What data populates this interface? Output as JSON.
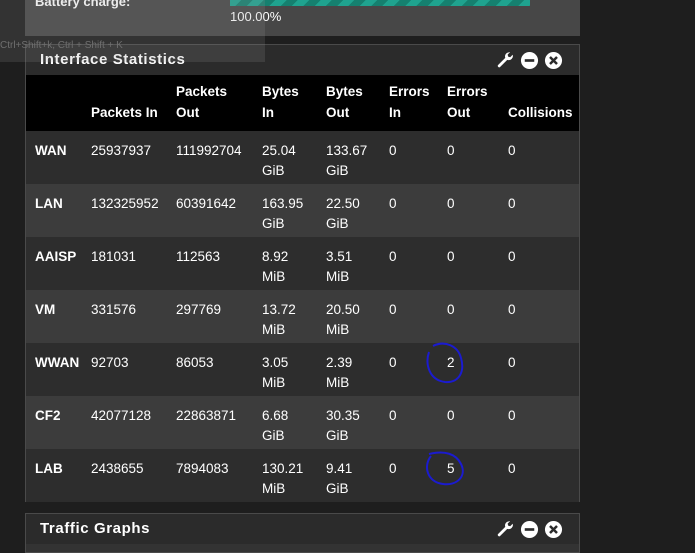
{
  "battery": {
    "label": "Battery charge:",
    "value": "100.00%",
    "charge_fraction": 1.0
  },
  "tooltip_ghost": {
    "text": "Ctrl+Shift+k, Ctrl + Shift + K"
  },
  "interface_statistics": {
    "title": "Interface Statistics",
    "headers": {
      "interface": "",
      "packets_in": "Packets In",
      "packets_out": "Packets Out",
      "bytes_in": "Bytes In",
      "bytes_out": "Bytes Out",
      "errors_in": "Errors In",
      "errors_out": "Errors Out",
      "collisions": "Collisions"
    },
    "rows": [
      {
        "name": "WAN",
        "packets_in": "25937937",
        "packets_out": "111992704",
        "bytes_in": "25.04 GiB",
        "bytes_out": "133.67 GiB",
        "errors_in": "0",
        "errors_out": "0",
        "collisions": "0"
      },
      {
        "name": "LAN",
        "packets_in": "132325952",
        "packets_out": "60391642",
        "bytes_in": "163.95 GiB",
        "bytes_out": "22.50 GiB",
        "errors_in": "0",
        "errors_out": "0",
        "collisions": "0"
      },
      {
        "name": "AAISP",
        "packets_in": "181031",
        "packets_out": "112563",
        "bytes_in": "8.92 MiB",
        "bytes_out": "3.51 MiB",
        "errors_in": "0",
        "errors_out": "0",
        "collisions": "0"
      },
      {
        "name": "VM",
        "packets_in": "331576",
        "packets_out": "297769",
        "bytes_in": "13.72 MiB",
        "bytes_out": "20.50 MiB",
        "errors_in": "0",
        "errors_out": "0",
        "collisions": "0"
      },
      {
        "name": "WWAN",
        "packets_in": "92703",
        "packets_out": "86053",
        "bytes_in": "3.05 MiB",
        "bytes_out": "2.39 MiB",
        "errors_in": "0",
        "errors_out": "2",
        "collisions": "0"
      },
      {
        "name": "CF2",
        "packets_in": "42077128",
        "packets_out": "22863871",
        "bytes_in": "6.68 GiB",
        "bytes_out": "30.35 GiB",
        "errors_in": "0",
        "errors_out": "0",
        "collisions": "0"
      },
      {
        "name": "LAB",
        "packets_in": "2438655",
        "packets_out": "7894083",
        "bytes_in": "130.21 MiB",
        "bytes_out": "9.41 GiB",
        "errors_in": "0",
        "errors_out": "5",
        "collisions": "0"
      }
    ]
  },
  "traffic_graphs": {
    "title": "Traffic Graphs"
  },
  "icons": {
    "settings": "wrench-icon",
    "minimize": "minus-circle-icon",
    "close": "close-circle-icon"
  },
  "colors": {
    "annotation_circle": "#1b1bd0",
    "battery_bar": "#1fa38f",
    "table_header_bg": "#000000"
  }
}
